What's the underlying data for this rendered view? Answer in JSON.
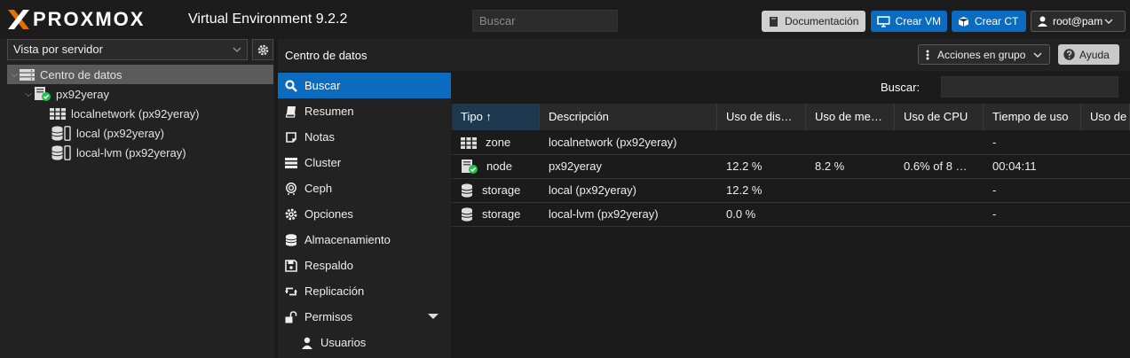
{
  "header": {
    "logo_text": "PROXMOX",
    "product": "Virtual Environment 9.2.2",
    "search_placeholder": "Buscar",
    "docs_label": "Documentación",
    "create_vm_label": "Crear VM",
    "create_ct_label": "Crear CT",
    "user_label": "root@pam",
    "accent_color": "#e57000",
    "button_color": "#0b6bbf"
  },
  "sidebar": {
    "view_label": "Vista por servidor",
    "tree": [
      {
        "label": "Centro de datos",
        "icon": "datacenter-icon"
      },
      {
        "label": "px92yeray",
        "icon": "node-online-icon"
      },
      {
        "label": "localnetwork (px92yeray)",
        "icon": "zone-grid-icon"
      },
      {
        "label": "local (px92yeray)",
        "icon": "storage-icon"
      },
      {
        "label": "local-lvm (px92yeray)",
        "icon": "storage-icon"
      }
    ]
  },
  "panel": {
    "title": "Centro de datos",
    "bulk_label": "Acciones en grupo",
    "help_label": "Ayuda"
  },
  "nav": [
    {
      "label": "Buscar",
      "icon": "search-icon"
    },
    {
      "label": "Resumen",
      "icon": "book-icon"
    },
    {
      "label": "Notas",
      "icon": "note-icon"
    },
    {
      "label": "Cluster",
      "icon": "server-icon"
    },
    {
      "label": "Ceph",
      "icon": "ceph-icon"
    },
    {
      "label": "Opciones",
      "icon": "gear-icon"
    },
    {
      "label": "Almacenamiento",
      "icon": "database-icon"
    },
    {
      "label": "Respaldo",
      "icon": "floppy-icon"
    },
    {
      "label": "Replicación",
      "icon": "retweet-icon"
    },
    {
      "label": "Permisos",
      "icon": "unlock-icon"
    },
    {
      "label": "Usuarios",
      "icon": "user-icon"
    }
  ],
  "grid": {
    "search_label": "Buscar:",
    "columns": [
      "Tipo ↑",
      "Descripción",
      "Uso de dis…",
      "Uso de me…",
      "Uso de CPU",
      "Tiempo de uso",
      "Uso de"
    ],
    "rows": [
      {
        "type": "zone",
        "desc": "localnetwork (px92yeray)",
        "disk": "",
        "mem": "",
        "cpu": "",
        "uptime": "-",
        "icon": "zone-grid-icon"
      },
      {
        "type": "node",
        "desc": "px92yeray",
        "disk": "12.2 %",
        "mem": "8.2 %",
        "cpu": "0.6% of 8 …",
        "uptime": "00:04:11",
        "icon": "node-online-icon"
      },
      {
        "type": "storage",
        "desc": "local (px92yeray)",
        "disk": "12.2 %",
        "mem": "",
        "cpu": "",
        "uptime": "-",
        "icon": "storage-icon"
      },
      {
        "type": "storage",
        "desc": "local-lvm (px92yeray)",
        "disk": "0.0 %",
        "mem": "",
        "cpu": "",
        "uptime": "-",
        "icon": "storage-icon"
      }
    ]
  }
}
